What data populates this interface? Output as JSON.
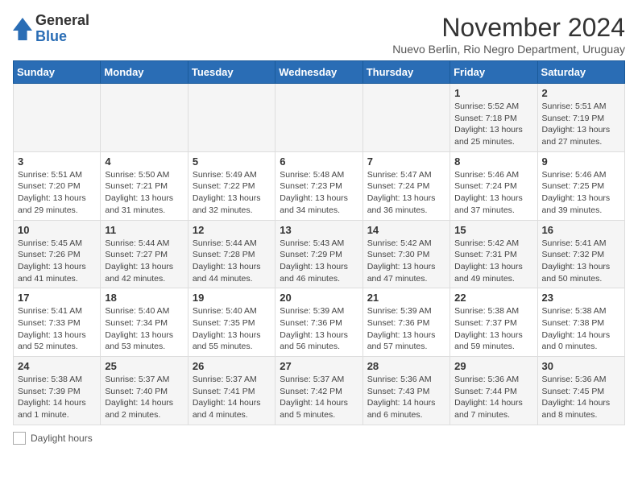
{
  "logo": {
    "general": "General",
    "blue": "Blue"
  },
  "header": {
    "month": "November 2024",
    "location": "Nuevo Berlin, Rio Negro Department, Uruguay"
  },
  "weekdays": [
    "Sunday",
    "Monday",
    "Tuesday",
    "Wednesday",
    "Thursday",
    "Friday",
    "Saturday"
  ],
  "weeks": [
    [
      {
        "day": "",
        "info": ""
      },
      {
        "day": "",
        "info": ""
      },
      {
        "day": "",
        "info": ""
      },
      {
        "day": "",
        "info": ""
      },
      {
        "day": "",
        "info": ""
      },
      {
        "day": "1",
        "info": "Sunrise: 5:52 AM\nSunset: 7:18 PM\nDaylight: 13 hours and 25 minutes."
      },
      {
        "day": "2",
        "info": "Sunrise: 5:51 AM\nSunset: 7:19 PM\nDaylight: 13 hours and 27 minutes."
      }
    ],
    [
      {
        "day": "3",
        "info": "Sunrise: 5:51 AM\nSunset: 7:20 PM\nDaylight: 13 hours and 29 minutes."
      },
      {
        "day": "4",
        "info": "Sunrise: 5:50 AM\nSunset: 7:21 PM\nDaylight: 13 hours and 31 minutes."
      },
      {
        "day": "5",
        "info": "Sunrise: 5:49 AM\nSunset: 7:22 PM\nDaylight: 13 hours and 32 minutes."
      },
      {
        "day": "6",
        "info": "Sunrise: 5:48 AM\nSunset: 7:23 PM\nDaylight: 13 hours and 34 minutes."
      },
      {
        "day": "7",
        "info": "Sunrise: 5:47 AM\nSunset: 7:24 PM\nDaylight: 13 hours and 36 minutes."
      },
      {
        "day": "8",
        "info": "Sunrise: 5:46 AM\nSunset: 7:24 PM\nDaylight: 13 hours and 37 minutes."
      },
      {
        "day": "9",
        "info": "Sunrise: 5:46 AM\nSunset: 7:25 PM\nDaylight: 13 hours and 39 minutes."
      }
    ],
    [
      {
        "day": "10",
        "info": "Sunrise: 5:45 AM\nSunset: 7:26 PM\nDaylight: 13 hours and 41 minutes."
      },
      {
        "day": "11",
        "info": "Sunrise: 5:44 AM\nSunset: 7:27 PM\nDaylight: 13 hours and 42 minutes."
      },
      {
        "day": "12",
        "info": "Sunrise: 5:44 AM\nSunset: 7:28 PM\nDaylight: 13 hours and 44 minutes."
      },
      {
        "day": "13",
        "info": "Sunrise: 5:43 AM\nSunset: 7:29 PM\nDaylight: 13 hours and 46 minutes."
      },
      {
        "day": "14",
        "info": "Sunrise: 5:42 AM\nSunset: 7:30 PM\nDaylight: 13 hours and 47 minutes."
      },
      {
        "day": "15",
        "info": "Sunrise: 5:42 AM\nSunset: 7:31 PM\nDaylight: 13 hours and 49 minutes."
      },
      {
        "day": "16",
        "info": "Sunrise: 5:41 AM\nSunset: 7:32 PM\nDaylight: 13 hours and 50 minutes."
      }
    ],
    [
      {
        "day": "17",
        "info": "Sunrise: 5:41 AM\nSunset: 7:33 PM\nDaylight: 13 hours and 52 minutes."
      },
      {
        "day": "18",
        "info": "Sunrise: 5:40 AM\nSunset: 7:34 PM\nDaylight: 13 hours and 53 minutes."
      },
      {
        "day": "19",
        "info": "Sunrise: 5:40 AM\nSunset: 7:35 PM\nDaylight: 13 hours and 55 minutes."
      },
      {
        "day": "20",
        "info": "Sunrise: 5:39 AM\nSunset: 7:36 PM\nDaylight: 13 hours and 56 minutes."
      },
      {
        "day": "21",
        "info": "Sunrise: 5:39 AM\nSunset: 7:36 PM\nDaylight: 13 hours and 57 minutes."
      },
      {
        "day": "22",
        "info": "Sunrise: 5:38 AM\nSunset: 7:37 PM\nDaylight: 13 hours and 59 minutes."
      },
      {
        "day": "23",
        "info": "Sunrise: 5:38 AM\nSunset: 7:38 PM\nDaylight: 14 hours and 0 minutes."
      }
    ],
    [
      {
        "day": "24",
        "info": "Sunrise: 5:38 AM\nSunset: 7:39 PM\nDaylight: 14 hours and 1 minute."
      },
      {
        "day": "25",
        "info": "Sunrise: 5:37 AM\nSunset: 7:40 PM\nDaylight: 14 hours and 2 minutes."
      },
      {
        "day": "26",
        "info": "Sunrise: 5:37 AM\nSunset: 7:41 PM\nDaylight: 14 hours and 4 minutes."
      },
      {
        "day": "27",
        "info": "Sunrise: 5:37 AM\nSunset: 7:42 PM\nDaylight: 14 hours and 5 minutes."
      },
      {
        "day": "28",
        "info": "Sunrise: 5:36 AM\nSunset: 7:43 PM\nDaylight: 14 hours and 6 minutes."
      },
      {
        "day": "29",
        "info": "Sunrise: 5:36 AM\nSunset: 7:44 PM\nDaylight: 14 hours and 7 minutes."
      },
      {
        "day": "30",
        "info": "Sunrise: 5:36 AM\nSunset: 7:45 PM\nDaylight: 14 hours and 8 minutes."
      }
    ]
  ],
  "legend": {
    "daylight_label": "Daylight hours"
  }
}
